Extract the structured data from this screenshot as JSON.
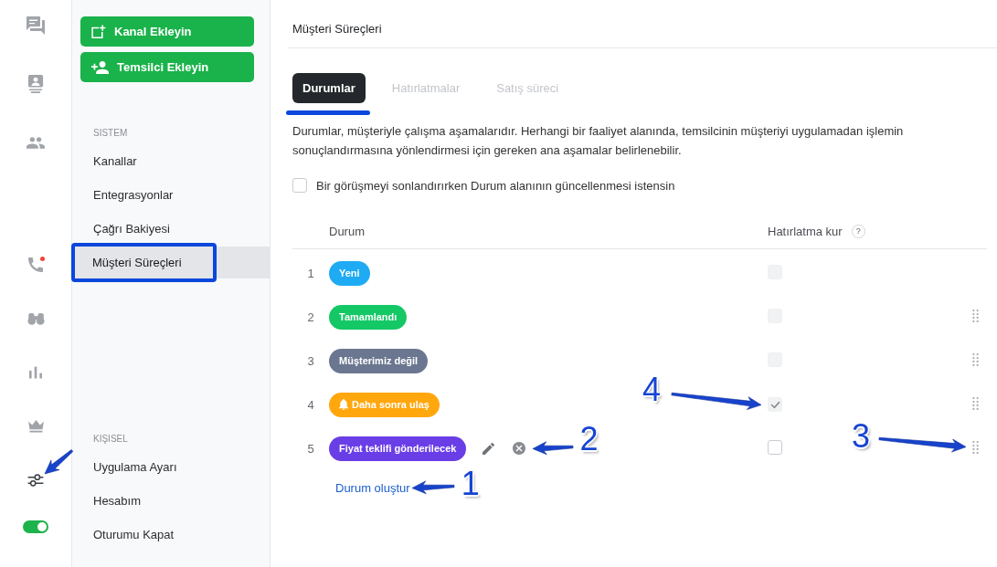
{
  "rail": {
    "top_items": [
      {
        "kind": "chat",
        "selected": false
      },
      {
        "kind": "contact-card",
        "selected": false
      },
      {
        "kind": "people",
        "selected": false
      }
    ],
    "bottom_items": [
      {
        "kind": "phone",
        "selected": false,
        "dot": true,
        "arrow": false
      },
      {
        "kind": "binoculars",
        "selected": false,
        "dot": false,
        "arrow": false
      },
      {
        "kind": "bar-chart",
        "selected": false,
        "dot": false,
        "arrow": false
      },
      {
        "kind": "crown",
        "selected": false,
        "dot": false,
        "arrow": false
      },
      {
        "kind": "sliders",
        "selected": true,
        "dot": false,
        "arrow": true
      }
    ],
    "toggle": {
      "on": true
    }
  },
  "sidebar": {
    "buttons": [
      {
        "kind": "add-box",
        "label": "Kanal Ekleyin"
      },
      {
        "kind": "person-add",
        "label": "Temsilci Ekleyin"
      }
    ],
    "sections": [
      {
        "title": "SISTEM",
        "items": [
          {
            "label": "Kanallar",
            "selected": false,
            "framed": false
          },
          {
            "label": "Entegrasyonlar",
            "selected": false,
            "framed": false
          },
          {
            "label": "Çağrı Bakiyesi",
            "selected": false,
            "framed": false
          },
          {
            "label": "Müşteri Süreçleri",
            "selected": true,
            "framed": true
          }
        ]
      },
      {
        "title": "KIŞISEL",
        "items": [
          {
            "label": "Uygulama Ayarı",
            "selected": false,
            "framed": false
          },
          {
            "label": "Hesabım",
            "selected": false,
            "framed": false
          },
          {
            "label": "Oturumu Kapat",
            "selected": false,
            "framed": false
          }
        ]
      }
    ]
  },
  "main": {
    "title": "Müşteri Süreçleri",
    "tabs": [
      {
        "label": "Durumlar",
        "selected": true,
        "underlined": true
      },
      {
        "label": "Hatırlatmalar",
        "selected": false,
        "underlined": false
      },
      {
        "label": "Satış süreci",
        "selected": false,
        "underlined": false
      }
    ],
    "description": "Durumlar, müşteriyle çalışma aşamalarıdır. Herhangi bir faaliyet alanında, temsilcinin müşteriyi uygulamadan işlemin sonuçlandırmasına yönlendirmesi için gereken ana aşamalar belirlenebilir.",
    "option": {
      "label": "Bir görüşmeyi sonlandırırken Durum alanının güncellenmesi istensin",
      "checked": false
    },
    "table": {
      "columns": [
        "Durum",
        "Hatırlatma kur"
      ],
      "help": "?",
      "rows": [
        {
          "number": "1",
          "status": "Yeni",
          "color": "#1fabf3",
          "bell": false,
          "show_actions": false,
          "reminder": {
            "checked": false,
            "disabled": true
          },
          "draggable": false
        },
        {
          "number": "2",
          "status": "Tamamlandı",
          "color": "#14c866",
          "bell": false,
          "show_actions": false,
          "reminder": {
            "checked": false,
            "disabled": true
          },
          "draggable": true
        },
        {
          "number": "3",
          "status": "Müşterimiz değil",
          "color": "#6b7790",
          "bell": false,
          "show_actions": false,
          "reminder": {
            "checked": false,
            "disabled": true
          },
          "draggable": true
        },
        {
          "number": "4",
          "status": "Daha sonra ulaş",
          "color": "#ffa70d",
          "bell": true,
          "show_actions": false,
          "reminder": {
            "checked": true,
            "disabled": true,
            "callout": "4"
          },
          "draggable": true
        },
        {
          "number": "5",
          "status": "Fiyat teklifi gönderilecek",
          "color": "#6a3ee6",
          "bell": false,
          "show_actions": true,
          "actions_callout": "2",
          "reminder": {
            "checked": false,
            "disabled": false
          },
          "draggable": true,
          "handle_callout": "3"
        }
      ]
    },
    "create_link": {
      "label": "Durum oluştur",
      "callout": "1"
    }
  }
}
